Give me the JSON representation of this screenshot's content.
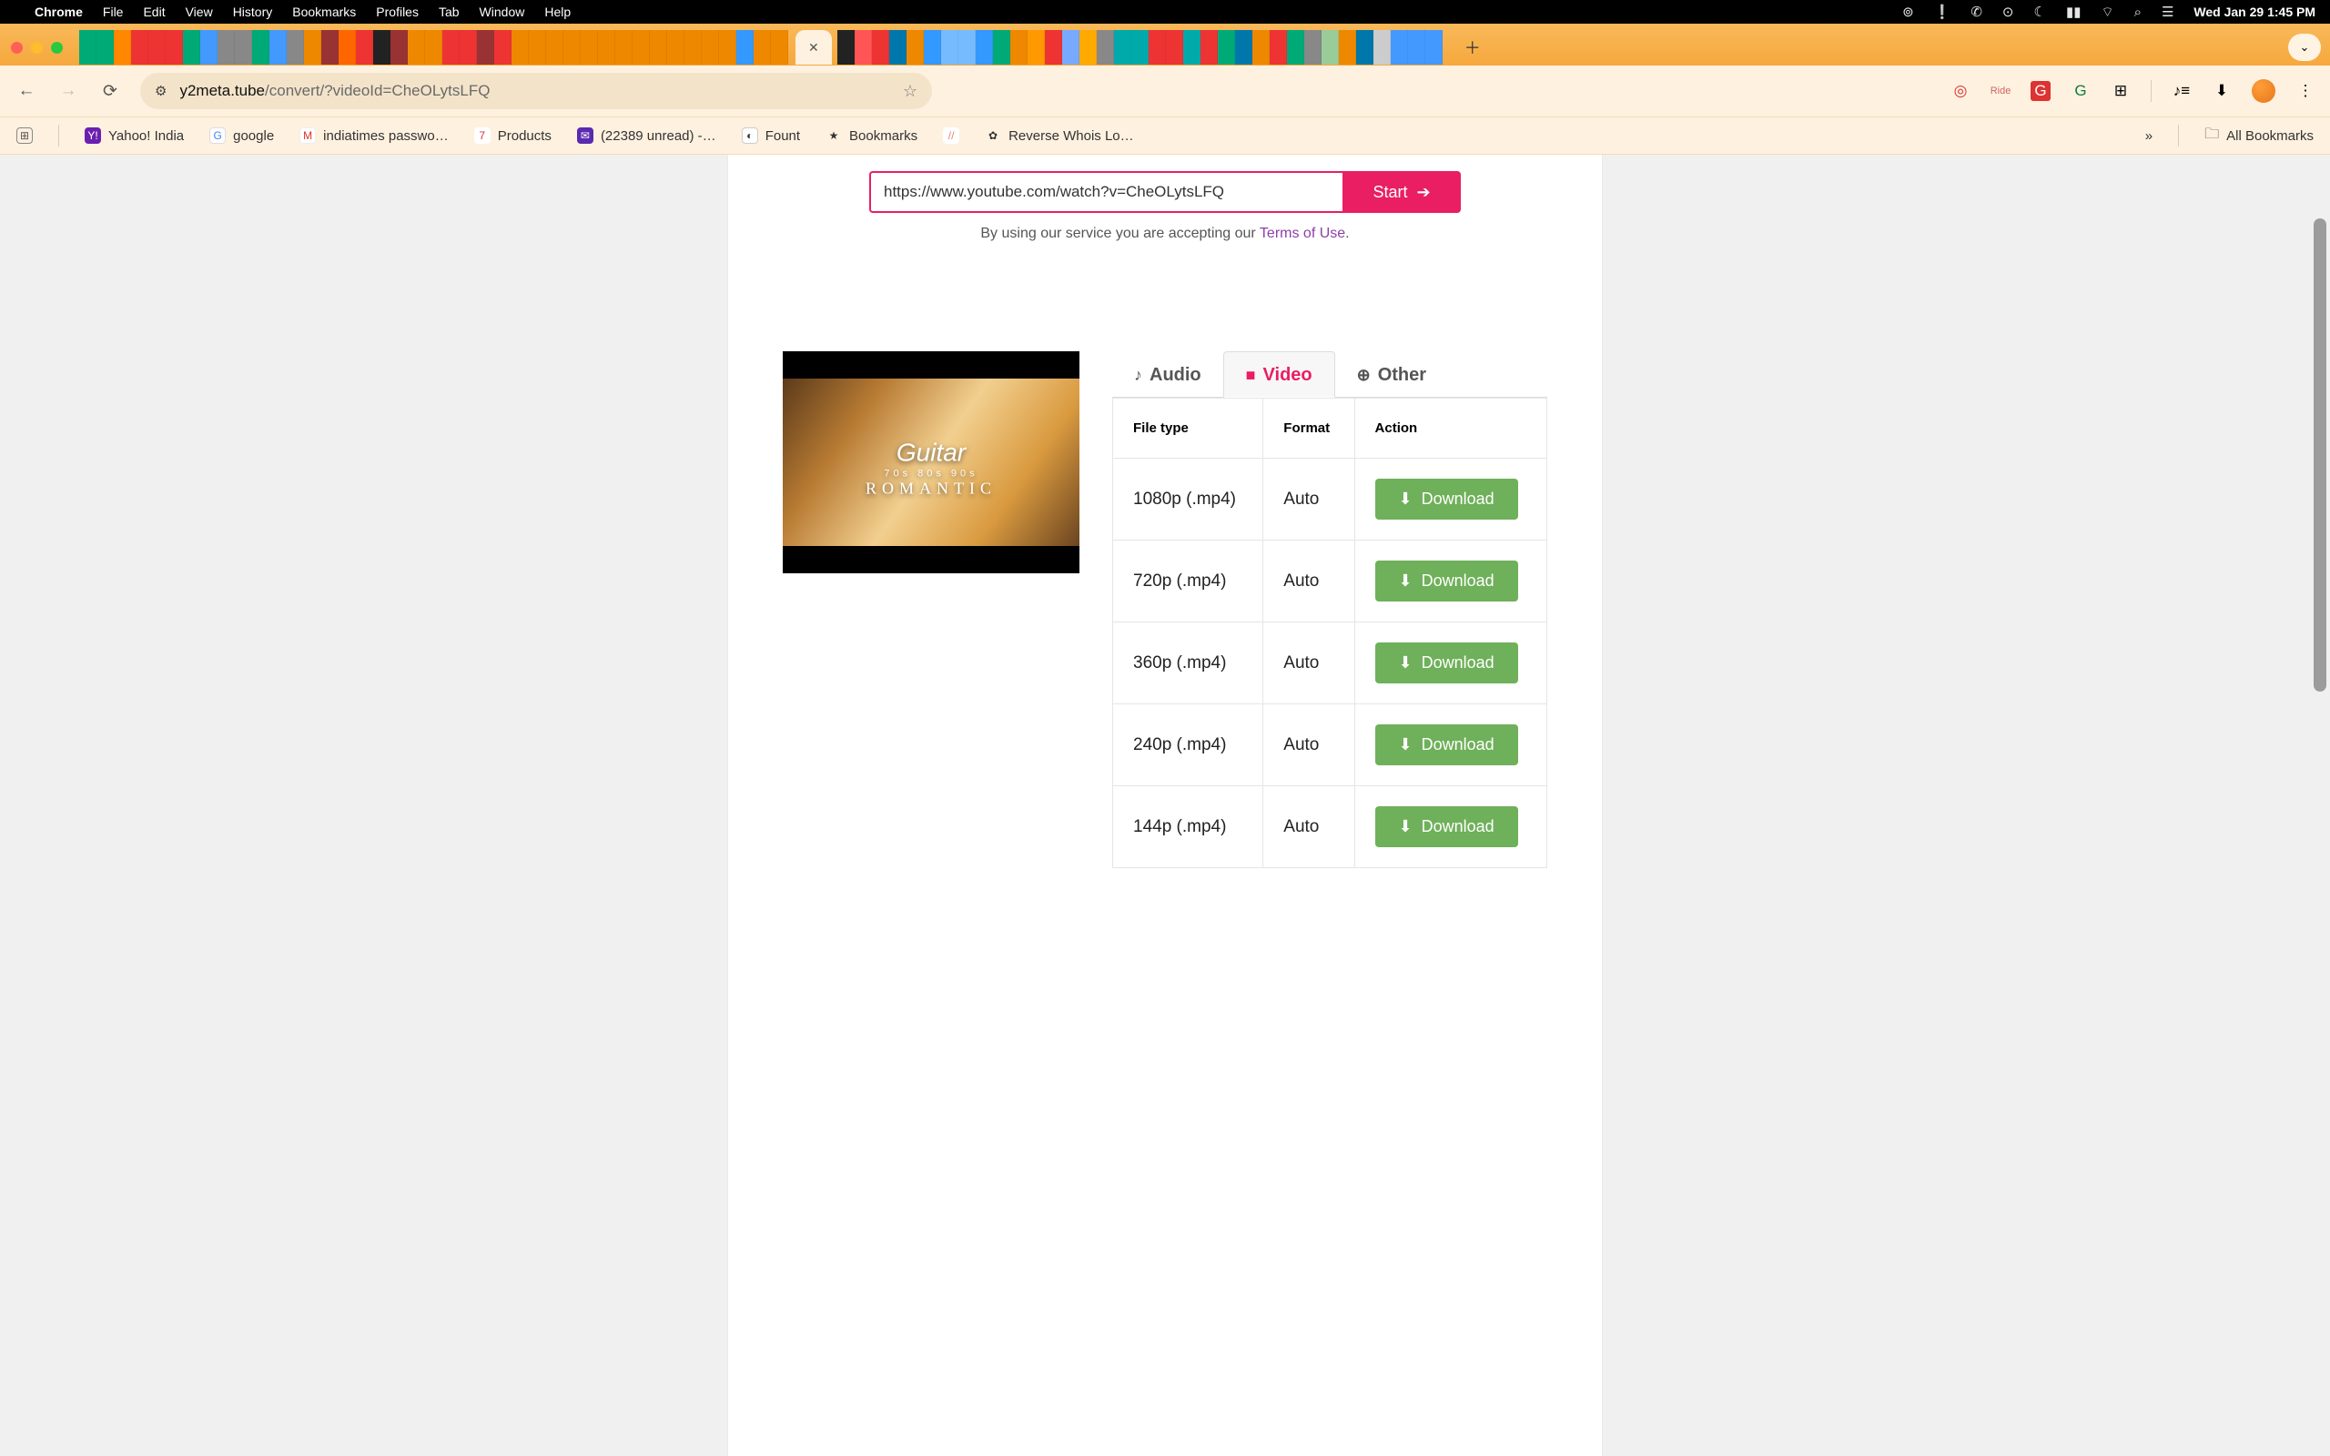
{
  "mac_menu": {
    "app_name": "Chrome",
    "items": [
      "File",
      "Edit",
      "View",
      "History",
      "Bookmarks",
      "Profiles",
      "Tab",
      "Window",
      "Help"
    ],
    "clock": "Wed Jan 29  1:45 PM"
  },
  "omnibox": {
    "host": "y2meta.tube",
    "path": "/convert/?videoId=CheOLytsLFQ"
  },
  "bookmarks_bar": {
    "items": [
      {
        "label": "Yahoo! India",
        "color": "#6b1fb1",
        "glyph": "Y!"
      },
      {
        "label": "google",
        "color": "#ffffff",
        "glyph": "G"
      },
      {
        "label": "indiatimes passwo…",
        "color": "#ffffff",
        "glyph": "M"
      },
      {
        "label": "Products",
        "color": "#ffffff",
        "glyph": "7"
      },
      {
        "label": "(22389 unread) -…",
        "color": "#5a2ab0",
        "glyph": "✉"
      },
      {
        "label": "Fount",
        "color": "#333",
        "glyph": "◐"
      },
      {
        "label": "Bookmarks",
        "color": "#333",
        "glyph": "★"
      },
      {
        "label": "",
        "color": "#ffd8b0",
        "glyph": "✎"
      },
      {
        "label": "Reverse Whois Lo…",
        "color": "#333",
        "glyph": "✿"
      }
    ],
    "more": "»",
    "all": "All Bookmarks"
  },
  "page": {
    "url_value": "https://www.youtube.com/watch?v=CheOLytsLFQ",
    "start_label": "Start",
    "terms_prefix": "By using our service you are accepting our ",
    "terms_link": "Terms of Use",
    "terms_suffix": ".",
    "thumbnail": {
      "title": "Guitar",
      "sub": "70s 80s 90s",
      "line2": "ROMANTIC"
    },
    "tabs": {
      "audio": "Audio",
      "video": "Video",
      "other": "Other"
    },
    "table": {
      "headers": {
        "filetype": "File type",
        "format": "Format",
        "action": "Action"
      },
      "rows": [
        {
          "filetype": "1080p (.mp4)",
          "format": "Auto",
          "action": "Download"
        },
        {
          "filetype": "720p (.mp4)",
          "format": "Auto",
          "action": "Download"
        },
        {
          "filetype": "360p (.mp4)",
          "format": "Auto",
          "action": "Download"
        },
        {
          "filetype": "240p (.mp4)",
          "format": "Auto",
          "action": "Download"
        },
        {
          "filetype": "144p (.mp4)",
          "format": "Auto",
          "action": "Download"
        }
      ]
    }
  },
  "tabstrip": {
    "left_icons_count": 41,
    "right_icons_count": 35,
    "active_tab_close": "✕"
  }
}
